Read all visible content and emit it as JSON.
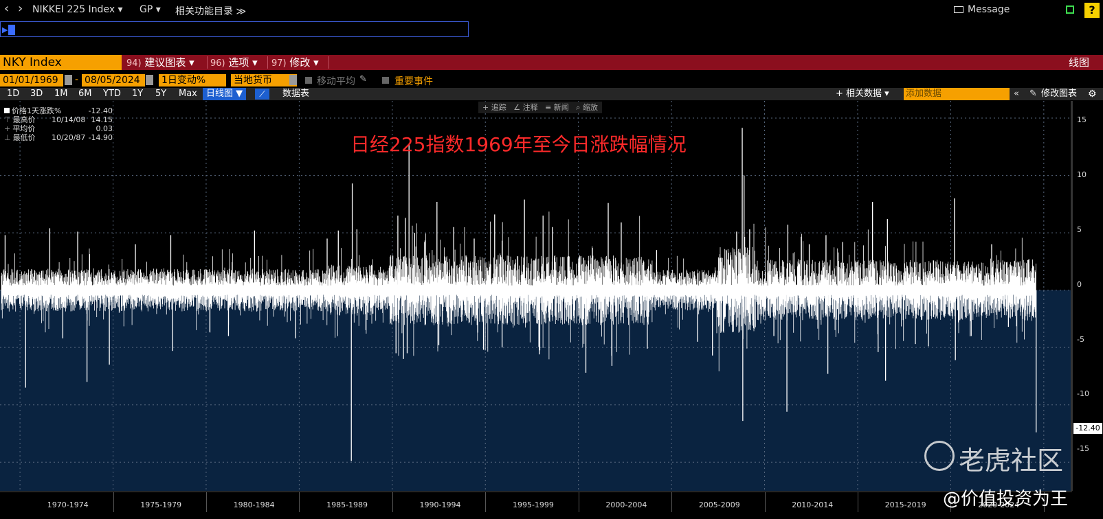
{
  "topbar": {
    "back": "‹",
    "fwd": "›",
    "security": "NIKKEI 225 Index ▾",
    "gp": "GP ▾",
    "related": "相关功能目录 ≫",
    "message": "Message",
    "help": "?"
  },
  "ticker": "NKY Index",
  "menu": [
    {
      "num": "94)",
      "label": "建议图表 ▾"
    },
    {
      "num": "96)",
      "label": "选项 ▾"
    },
    {
      "num": "97)",
      "label": "修改 ▾"
    }
  ],
  "chart_type_label": "线图",
  "controls": {
    "start_date": "01/01/1969",
    "end_date": "08/05/2024",
    "dash": "-",
    "field": "1日变动%",
    "currency": "当地货币",
    "moving_avg": "移动平均",
    "events": "重要事件"
  },
  "periods": [
    "1D",
    "3D",
    "1M",
    "6M",
    "YTD",
    "1Y",
    "5Y",
    "Max"
  ],
  "active_view": "日线图 ▼",
  "data_table": "数据表",
  "related_data": "+ 相关数据 ▾",
  "add_data_placeholder": "添加数据",
  "edit_chart": "修改图表",
  "tools": [
    "+ 追踪",
    "∠ 注释",
    "≡ 新闻",
    "⌕ 缩放"
  ],
  "legend": [
    {
      "label": "价格1天涨跌%",
      "date": "",
      "value": "-12.40"
    },
    {
      "label": "最高价",
      "date": "10/14/08",
      "value": "14.15"
    },
    {
      "label": "平均价",
      "date": "",
      "value": "0.03"
    },
    {
      "label": "最低价",
      "date": "10/20/87",
      "value": "-14.90"
    }
  ],
  "last_value": "-12.40",
  "watermark": {
    "brand": "老虎社区",
    "author": "@价值投资为王"
  },
  "chart_data": {
    "type": "line",
    "title": "日经225指数1969年至今日涨跌幅情况",
    "ylim": [
      -17.5,
      16.5
    ],
    "yticks": [
      15,
      10,
      5,
      0,
      -5,
      -10,
      -15
    ],
    "x_categories": [
      "1970-1974",
      "1975-1979",
      "1980-1984",
      "1985-1989",
      "1990-1994",
      "1995-1999",
      "2000-2004",
      "2005-2009",
      "2010-2014",
      "2015-2019",
      "2020-2024"
    ],
    "xlim_years": [
      1969.0,
      2024.6
    ],
    "series": [
      {
        "name": "价格1天涨跌%",
        "color": "#ffffff",
        "note_points_year_value": true,
        "points": [
          [
            1969.2,
            4.8
          ],
          [
            1970.3,
            -8.5
          ],
          [
            1971.6,
            5.4
          ],
          [
            1972.3,
            -4.2
          ],
          [
            1973.1,
            5.1
          ],
          [
            1973.6,
            -8.0
          ],
          [
            1974.8,
            -6.5
          ],
          [
            1976.2,
            4.0
          ],
          [
            1978.1,
            4.8
          ],
          [
            1978.2,
            -5.3
          ],
          [
            1981.2,
            -4.0
          ],
          [
            1982.6,
            5.2
          ],
          [
            1984.8,
            -4.2
          ],
          [
            1986.5,
            4.5
          ],
          [
            1987.1,
            5.2
          ],
          [
            1987.8,
            -14.9
          ],
          [
            1987.85,
            9.3
          ],
          [
            1988.1,
            5.3
          ],
          [
            1990.2,
            -5.5
          ],
          [
            1990.3,
            6.5
          ],
          [
            1990.6,
            -6.0
          ],
          [
            1990.7,
            6.3
          ],
          [
            1990.8,
            -5.5
          ],
          [
            1990.9,
            12.7
          ],
          [
            1991.2,
            5.0
          ],
          [
            1992.4,
            7.7
          ],
          [
            1992.5,
            -4.8
          ],
          [
            1993.3,
            5.5
          ],
          [
            1994.4,
            4.5
          ],
          [
            1994.9,
            -5.2
          ],
          [
            1995.5,
            6.6
          ],
          [
            1995.9,
            -5.0
          ],
          [
            1997.1,
            7.9
          ],
          [
            1997.9,
            -5.6
          ],
          [
            1998.1,
            6.5
          ],
          [
            1998.6,
            5.5
          ],
          [
            2000.4,
            -7.2
          ],
          [
            2001.6,
            7.6
          ],
          [
            2001.8,
            -6.6
          ],
          [
            2002.3,
            5.9
          ],
          [
            2003.7,
            -5.1
          ],
          [
            2004.2,
            3.5
          ],
          [
            2006.4,
            -4.5
          ],
          [
            2007.2,
            -5.7
          ],
          [
            2008.5,
            5.1
          ],
          [
            2008.8,
            14.15
          ],
          [
            2008.83,
            -11.4
          ],
          [
            2008.9,
            10.0
          ],
          [
            2009.2,
            5.3
          ],
          [
            2010.5,
            -4.0
          ],
          [
            2011.2,
            -10.6
          ],
          [
            2011.25,
            5.7
          ],
          [
            2012.4,
            4.0
          ],
          [
            2013.3,
            4.8
          ],
          [
            2013.4,
            -7.3
          ],
          [
            2014.2,
            4.2
          ],
          [
            2015.8,
            7.7
          ],
          [
            2016.1,
            -5.4
          ],
          [
            2016.5,
            -7.9
          ],
          [
            2016.6,
            6.2
          ],
          [
            2018.1,
            -4.7
          ],
          [
            2018.8,
            -4.9
          ],
          [
            2020.2,
            8.0
          ],
          [
            2020.25,
            -6.1
          ],
          [
            2021.1,
            -4.0
          ],
          [
            2022.2,
            4.0
          ],
          [
            2023.1,
            -3.2
          ],
          [
            2024.2,
            2.7
          ],
          [
            2024.59,
            -12.4
          ]
        ]
      }
    ]
  }
}
